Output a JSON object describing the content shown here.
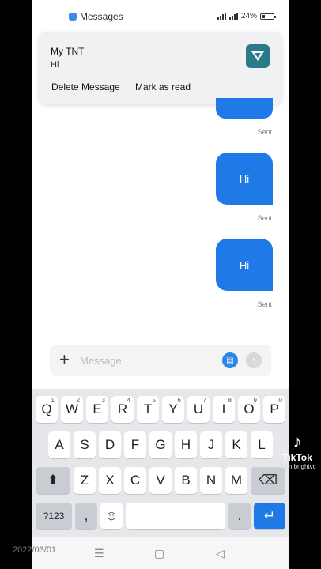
{
  "status_bar": {
    "app_name": "Messages",
    "battery": "24%"
  },
  "notification": {
    "title": "My TNT",
    "body": "Hi",
    "actions": {
      "delete": "Delete Message",
      "read": "Mark as read"
    }
  },
  "messages": [
    {
      "text": "Hi",
      "status": "Sent"
    },
    {
      "text": "Hi",
      "status": "Sent"
    }
  ],
  "top_message_status": "Sent",
  "composer": {
    "placeholder": "Message"
  },
  "keyboard": {
    "row1": [
      {
        "k": "Q",
        "h": "1"
      },
      {
        "k": "W",
        "h": "2"
      },
      {
        "k": "E",
        "h": "3"
      },
      {
        "k": "R",
        "h": "4"
      },
      {
        "k": "T",
        "h": "5"
      },
      {
        "k": "Y",
        "h": "6"
      },
      {
        "k": "U",
        "h": "7"
      },
      {
        "k": "I",
        "h": "8"
      },
      {
        "k": "O",
        "h": "9"
      },
      {
        "k": "P",
        "h": "0"
      }
    ],
    "row2": [
      "A",
      "S",
      "D",
      "F",
      "G",
      "H",
      "J",
      "K",
      "L"
    ],
    "row3": [
      "Z",
      "X",
      "C",
      "V",
      "B",
      "N",
      "M"
    ],
    "symbols_key": "?123",
    "comma_key": ",",
    "period_key": "."
  },
  "overlay": {
    "date": "2022/03/01",
    "app": "TikTok",
    "handle": "@hn.brightvc"
  },
  "colors": {
    "accent": "#1f7ae8",
    "logo": "#2a7a8a"
  }
}
